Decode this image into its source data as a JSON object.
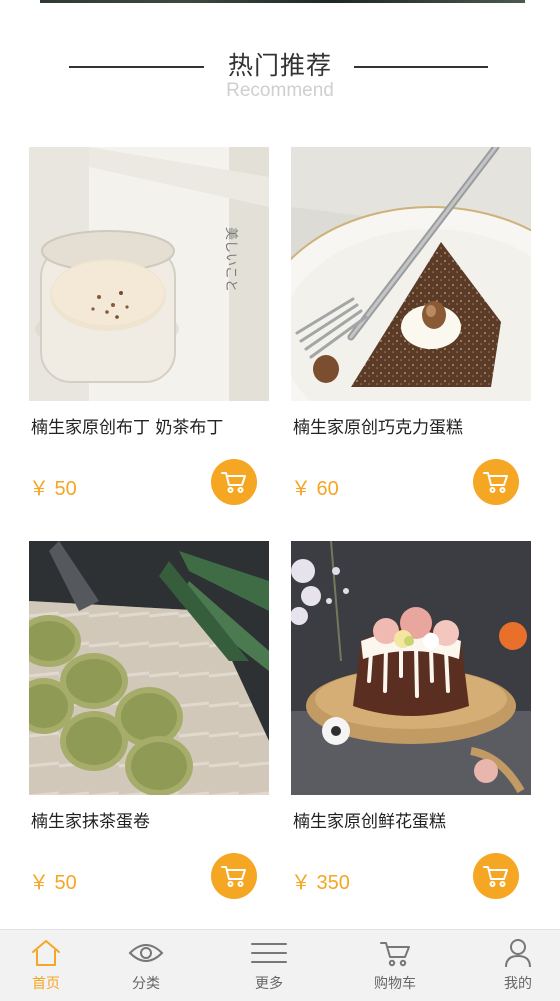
{
  "section": {
    "title": "热门推荐",
    "subtitle": "Recommend"
  },
  "products": [
    {
      "name": "楠生家原创布丁 奶茶布丁",
      "price": "￥ 50",
      "image": "pudding-jar-photo"
    },
    {
      "name": "楠生家原创巧克力蛋糕",
      "price": "￥ 60",
      "image": "chocolate-cake-slice-photo"
    },
    {
      "name": "楠生家抹茶蛋卷",
      "price": "￥ 50",
      "image": "matcha-cookies-photo"
    },
    {
      "name": "楠生家原创鲜花蛋糕",
      "price": "￥ 350",
      "image": "flower-bundt-cake-photo"
    }
  ],
  "tabbar": {
    "items": [
      {
        "label": "首页",
        "icon": "home-icon",
        "active": true
      },
      {
        "label": "分类",
        "icon": "eye-icon",
        "active": false
      },
      {
        "label": "更多",
        "icon": "menu-lines-icon",
        "active": false
      },
      {
        "label": "购物车",
        "icon": "cart-icon",
        "active": false
      },
      {
        "label": "我的",
        "icon": "user-icon",
        "active": false
      }
    ]
  },
  "colors": {
    "accent": "#f5a623",
    "text": "#222222",
    "subtitle": "#cfcfcf",
    "tabbar_bg": "#f2f2f2"
  }
}
